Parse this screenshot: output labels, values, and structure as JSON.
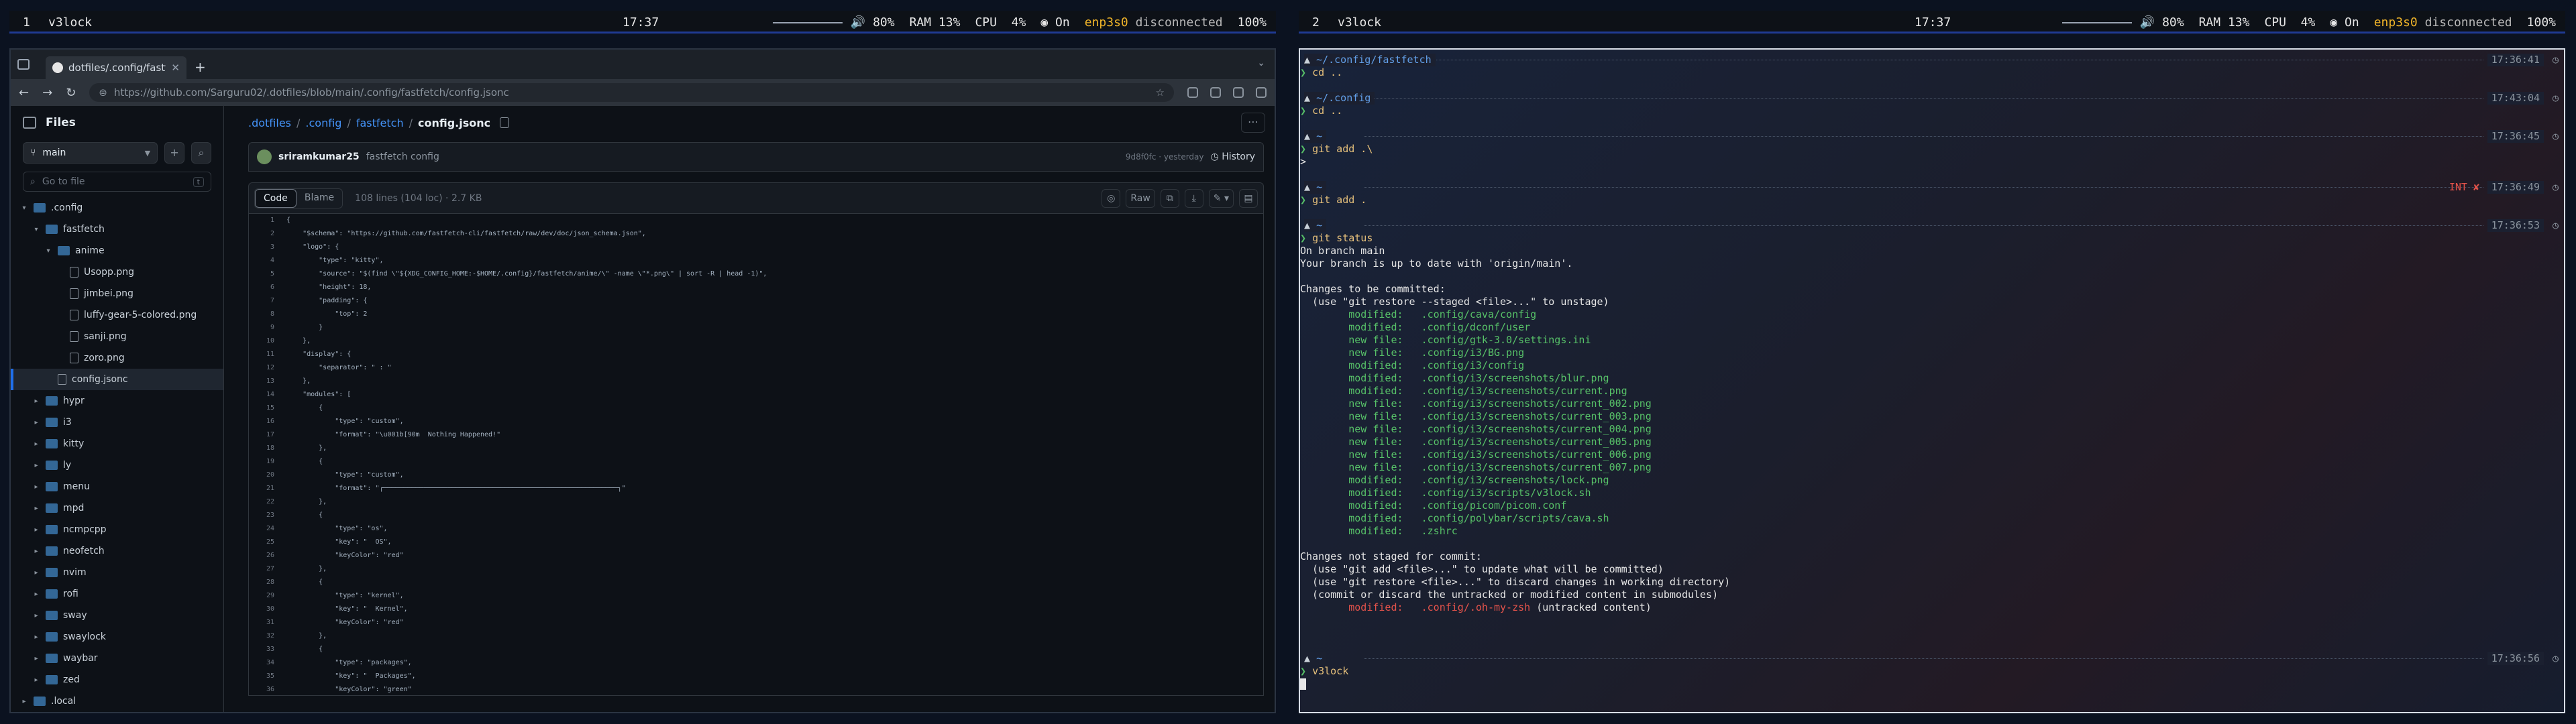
{
  "bars": [
    {
      "ws": "1",
      "name": "v3lock",
      "clock": "17:37",
      "vol": "80%",
      "ram": "RAM 13%",
      "cpu_label": "CPU",
      "cpu": "4%",
      "wifi": "On",
      "iface": "enp3s0",
      "iface_state": "disconnected",
      "battery": "100%"
    },
    {
      "ws": "2",
      "name": "v3lock",
      "clock": "17:37",
      "vol": "80%",
      "ram": "RAM 13%",
      "cpu_label": "CPU",
      "cpu": "4%",
      "wifi": "On",
      "iface": "enp3s0",
      "iface_state": "disconnected",
      "battery": "100%"
    }
  ],
  "browser": {
    "tab_title": "dotfiles/.config/fastfetch",
    "url": "https://github.com/Sarguru02/.dotfiles/blob/main/.config/fastfetch/config.jsonc",
    "files_title": "Files",
    "branch": "main",
    "goto_placeholder": "Go to file",
    "goto_kbd": "t",
    "tree": [
      {
        "depth": 0,
        "type": "folder",
        "open": true,
        "label": ".config"
      },
      {
        "depth": 1,
        "type": "folder",
        "open": true,
        "label": "fastfetch"
      },
      {
        "depth": 2,
        "type": "folder",
        "open": true,
        "label": "anime"
      },
      {
        "depth": 3,
        "type": "file",
        "label": "Usopp.png"
      },
      {
        "depth": 3,
        "type": "file",
        "label": "jimbei.png"
      },
      {
        "depth": 3,
        "type": "file",
        "label": "luffy-gear-5-colored.png"
      },
      {
        "depth": 3,
        "type": "file",
        "label": "sanji.png"
      },
      {
        "depth": 3,
        "type": "file",
        "label": "zoro.png"
      },
      {
        "depth": 2,
        "type": "file",
        "label": "config.jsonc",
        "selected": true
      },
      {
        "depth": 1,
        "type": "folder",
        "open": false,
        "label": "hypr"
      },
      {
        "depth": 1,
        "type": "folder",
        "open": false,
        "label": "i3"
      },
      {
        "depth": 1,
        "type": "folder",
        "open": false,
        "label": "kitty"
      },
      {
        "depth": 1,
        "type": "folder",
        "open": false,
        "label": "ly"
      },
      {
        "depth": 1,
        "type": "folder",
        "open": false,
        "label": "menu"
      },
      {
        "depth": 1,
        "type": "folder",
        "open": false,
        "label": "mpd"
      },
      {
        "depth": 1,
        "type": "folder",
        "open": false,
        "label": "ncmpcpp"
      },
      {
        "depth": 1,
        "type": "folder",
        "open": false,
        "label": "neofetch"
      },
      {
        "depth": 1,
        "type": "folder",
        "open": false,
        "label": "nvim"
      },
      {
        "depth": 1,
        "type": "folder",
        "open": false,
        "label": "rofi"
      },
      {
        "depth": 1,
        "type": "folder",
        "open": false,
        "label": "sway"
      },
      {
        "depth": 1,
        "type": "folder",
        "open": false,
        "label": "swaylock"
      },
      {
        "depth": 1,
        "type": "folder",
        "open": false,
        "label": "waybar"
      },
      {
        "depth": 1,
        "type": "folder",
        "open": false,
        "label": "zed"
      },
      {
        "depth": 0,
        "type": "folder",
        "open": false,
        "label": ".local"
      }
    ],
    "breadcrumb": [
      ".dotfiles",
      ".config",
      "fastfetch"
    ],
    "breadcrumb_current": "config.jsonc",
    "commit_author": "sriramkumar25",
    "commit_message": "fastfetch config",
    "commit_sha": "9d8f0fc · yesterday",
    "history_label": "History",
    "code_tab": "Code",
    "blame_tab": "Blame",
    "file_meta": "108 lines (104 loc) · 2.7 KB",
    "raw_label": "Raw",
    "code_lines": [
      "{",
      "    \"$schema\": \"https://github.com/fastfetch-cli/fastfetch/raw/dev/doc/json_schema.json\",",
      "    \"logo\": {",
      "        \"type\": \"kitty\",",
      "        \"source\": \"$(find \\\"${XDG_CONFIG_HOME:-$HOME/.config}/fastfetch/anime/\\\" -name \\\"*.png\\\" | sort -R | head -1)\",",
      "        \"height\": 18,",
      "        \"padding\": {",
      "            \"top\": 2",
      "        }",
      "    },",
      "    \"display\": {",
      "        \"separator\": \" : \"",
      "    },",
      "    \"modules\": [",
      "        {",
      "            \"type\": \"custom\",",
      "            \"format\": \"\\u001b[90m  Nothing Happened!\"",
      "        },",
      "        {",
      "            \"type\": \"custom\",",
      "            \"format\": \"┌──────────────────────────────────────────────────────────┐\"",
      "        },",
      "        {",
      "            \"type\": \"os\",",
      "            \"key\": \"  OS\",",
      "            \"keyColor\": \"red\"",
      "        },",
      "        {",
      "            \"type\": \"kernel\",",
      "            \"key\": \"  Kernel\",",
      "            \"keyColor\": \"red\"",
      "        },",
      "        {",
      "            \"type\": \"packages\",",
      "            \"key\": \"  Packages\",",
      "            \"keyColor\": \"green\""
    ]
  },
  "terminal": {
    "blocks": [
      {
        "dir": "~/.config/fastfetch",
        "time": "17:36:41",
        "cmd": "cd ..",
        "out": []
      },
      {
        "dir": "~/.config",
        "time": "17:43:04",
        "cmd": "cd ..",
        "out": []
      },
      {
        "dir": "~",
        "time": "17:36:45",
        "cmd": "git add .\\",
        "out": [
          {
            "t": ">",
            "c": ""
          }
        ]
      },
      {
        "dir": "~",
        "time": "17:36:49",
        "err": "INT ✘",
        "cmd": "git add .",
        "out": []
      },
      {
        "dir": "~",
        "time": "17:36:53",
        "cmd": "git status",
        "out": [
          {
            "t": "On branch main",
            "c": ""
          },
          {
            "t": "Your branch is up to date with 'origin/main'.",
            "c": ""
          },
          {
            "t": "",
            "c": ""
          },
          {
            "t": "Changes to be committed:",
            "c": ""
          },
          {
            "t": "  (use \"git restore --staged <file>...\" to unstage)",
            "c": ""
          },
          {
            "t": "        modified:   .config/cava/config",
            "c": "green"
          },
          {
            "t": "        modified:   .config/dconf/user",
            "c": "green"
          },
          {
            "t": "        new file:   .config/gtk-3.0/settings.ini",
            "c": "green"
          },
          {
            "t": "        new file:   .config/i3/BG.png",
            "c": "green"
          },
          {
            "t": "        modified:   .config/i3/config",
            "c": "green"
          },
          {
            "t": "        modified:   .config/i3/screenshots/blur.png",
            "c": "green"
          },
          {
            "t": "        modified:   .config/i3/screenshots/current.png",
            "c": "green"
          },
          {
            "t": "        new file:   .config/i3/screenshots/current_002.png",
            "c": "green"
          },
          {
            "t": "        new file:   .config/i3/screenshots/current_003.png",
            "c": "green"
          },
          {
            "t": "        new file:   .config/i3/screenshots/current_004.png",
            "c": "green"
          },
          {
            "t": "        new file:   .config/i3/screenshots/current_005.png",
            "c": "green"
          },
          {
            "t": "        new file:   .config/i3/screenshots/current_006.png",
            "c": "green"
          },
          {
            "t": "        new file:   .config/i3/screenshots/current_007.png",
            "c": "green"
          },
          {
            "t": "        modified:   .config/i3/screenshots/lock.png",
            "c": "green"
          },
          {
            "t": "        modified:   .config/i3/scripts/v3lock.sh",
            "c": "green"
          },
          {
            "t": "        modified:   .config/picom/picom.conf",
            "c": "green"
          },
          {
            "t": "        modified:   .config/polybar/scripts/cava.sh",
            "c": "green"
          },
          {
            "t": "        modified:   .zshrc",
            "c": "green"
          },
          {
            "t": "",
            "c": ""
          },
          {
            "t": "Changes not staged for commit:",
            "c": ""
          },
          {
            "t": "  (use \"git add <file>...\" to update what will be committed)",
            "c": ""
          },
          {
            "t": "  (use \"git restore <file>...\" to discard changes in working directory)",
            "c": ""
          },
          {
            "t": "  (commit or discard the untracked or modified content in submodules)",
            "c": ""
          },
          {
            "t": "        modified:   .config/.oh-my-zsh",
            "c": "red",
            "suffix": " (untracked content)"
          },
          {
            "t": "",
            "c": ""
          },
          {
            "t": "",
            "c": ""
          }
        ]
      },
      {
        "dir": "~",
        "time": "17:36:56",
        "cmd": "v3lock",
        "out": [],
        "cursor": true
      }
    ]
  }
}
